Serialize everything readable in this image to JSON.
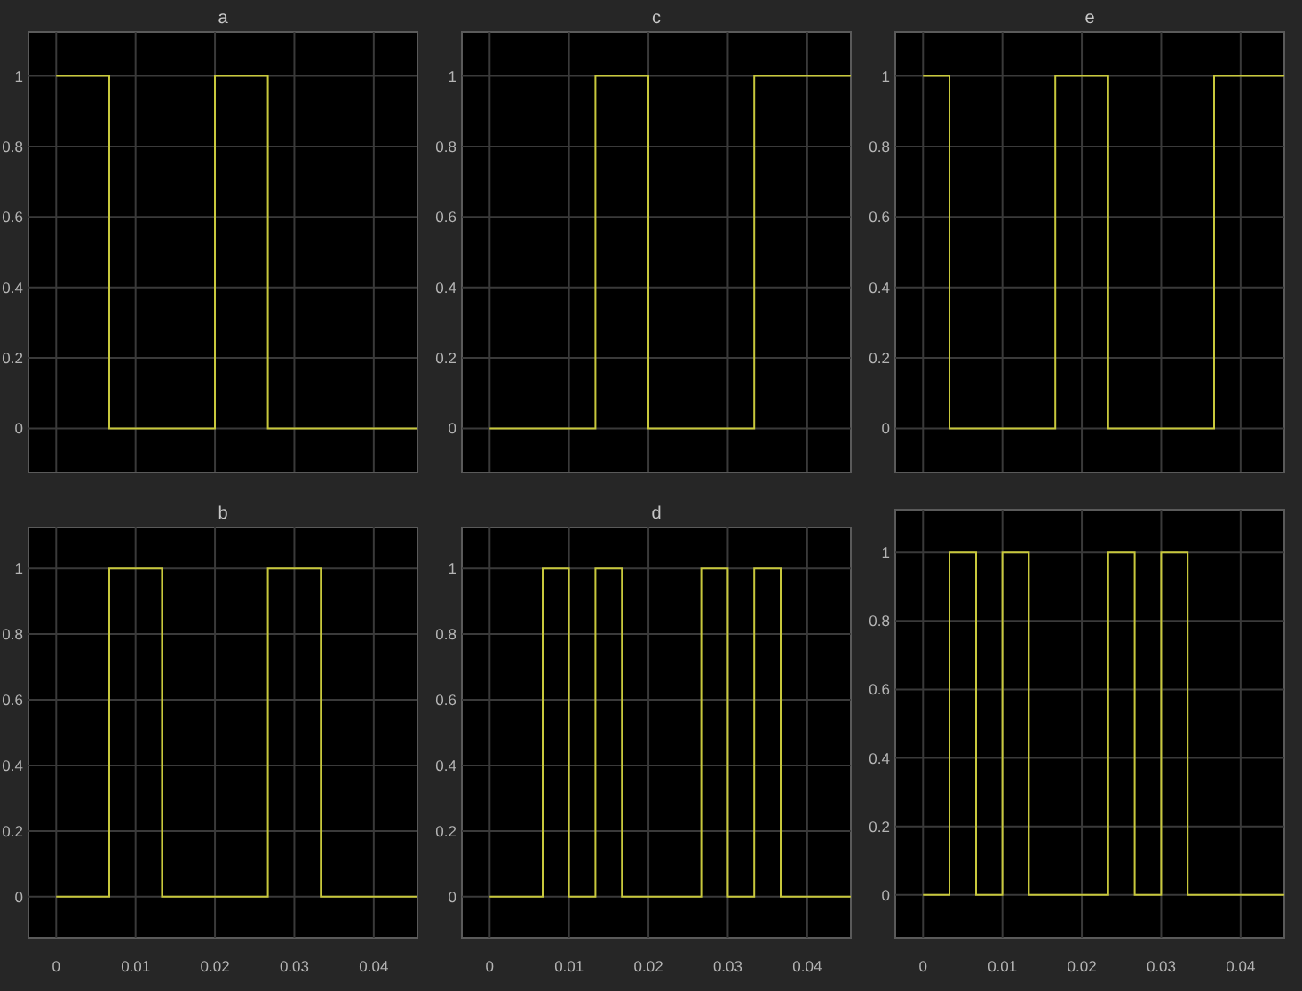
{
  "charts": [
    {
      "chart_data": {
        "type": "line",
        "title": "a",
        "grid": true,
        "xlim": [
          -0.0035,
          0.0455
        ],
        "ylim": [
          -0.125,
          1.125
        ],
        "yticks": [
          0,
          0.2,
          0.4,
          0.6,
          0.8,
          1
        ],
        "x": [
          0,
          0.00667,
          0.00667,
          0.02,
          0.02,
          0.02667,
          0.02667,
          0.0455
        ],
        "series": [
          {
            "color": "#c8c83c",
            "values": [
              1,
              1,
              0,
              0,
              1,
              1,
              0,
              0
            ]
          }
        ]
      }
    },
    {
      "chart_data": {
        "type": "line",
        "title": "c",
        "grid": true,
        "xlim": [
          -0.0035,
          0.0455
        ],
        "ylim": [
          -0.125,
          1.125
        ],
        "yticks": [
          0,
          0.2,
          0.4,
          0.6,
          0.8,
          1
        ],
        "x": [
          0,
          0.01333,
          0.01333,
          0.02,
          0.02,
          0.03333,
          0.03333,
          0.0455
        ],
        "series": [
          {
            "color": "#c8c83c",
            "values": [
              0,
              0,
              1,
              1,
              0,
              0,
              1,
              1
            ]
          }
        ]
      }
    },
    {
      "chart_data": {
        "type": "line",
        "title": "e",
        "grid": true,
        "xlim": [
          -0.0035,
          0.0455
        ],
        "ylim": [
          -0.125,
          1.125
        ],
        "yticks": [
          0,
          0.2,
          0.4,
          0.6,
          0.8,
          1
        ],
        "x": [
          0,
          0.00333,
          0.00333,
          0.01667,
          0.01667,
          0.02333,
          0.02333,
          0.03667,
          0.03667,
          0.0455
        ],
        "series": [
          {
            "color": "#c8c83c",
            "values": [
              1,
              1,
              0,
              0,
              1,
              1,
              0,
              0,
              1,
              1
            ]
          }
        ]
      }
    },
    {
      "chart_data": {
        "type": "line",
        "title": "b",
        "grid": true,
        "xlim": [
          -0.0035,
          0.0455
        ],
        "ylim": [
          -0.125,
          1.125
        ],
        "xticks": [
          0,
          0.01,
          0.02,
          0.03,
          0.04
        ],
        "yticks": [
          0,
          0.2,
          0.4,
          0.6,
          0.8,
          1
        ],
        "x": [
          0,
          0.00667,
          0.00667,
          0.01333,
          0.01333,
          0.02667,
          0.02667,
          0.03333,
          0.03333,
          0.0455
        ],
        "series": [
          {
            "color": "#c8c83c",
            "values": [
              0,
              0,
              1,
              1,
              0,
              0,
              1,
              1,
              0,
              0
            ]
          }
        ]
      }
    },
    {
      "chart_data": {
        "type": "line",
        "title": "d",
        "grid": true,
        "xlim": [
          -0.0035,
          0.0455
        ],
        "ylim": [
          -0.125,
          1.125
        ],
        "xticks": [
          0,
          0.01,
          0.02,
          0.03,
          0.04
        ],
        "yticks": [
          0,
          0.2,
          0.4,
          0.6,
          0.8,
          1
        ],
        "x": [
          0,
          0.00667,
          0.00667,
          0.01,
          0.01,
          0.01333,
          0.01333,
          0.01667,
          0.01667,
          0.02667,
          0.02667,
          0.03,
          0.03,
          0.03333,
          0.03333,
          0.03667,
          0.03667,
          0.0455
        ],
        "series": [
          {
            "color": "#c8c83c",
            "values": [
              0,
              0,
              1,
              1,
              0,
              0,
              1,
              1,
              0,
              0,
              1,
              1,
              0,
              0,
              1,
              1,
              0,
              0
            ]
          }
        ]
      }
    },
    {
      "chart_data": {
        "type": "line",
        "grid": true,
        "xlim": [
          -0.0035,
          0.0455
        ],
        "ylim": [
          -0.125,
          1.125
        ],
        "xticks": [
          0,
          0.01,
          0.02,
          0.03,
          0.04
        ],
        "yticks": [
          0,
          0.2,
          0.4,
          0.6,
          0.8,
          1
        ],
        "x": [
          0,
          0.00333,
          0.00333,
          0.00667,
          0.00667,
          0.01,
          0.01,
          0.01333,
          0.01333,
          0.02333,
          0.02333,
          0.02667,
          0.02667,
          0.03,
          0.03,
          0.03333,
          0.03333,
          0.0455
        ],
        "series": [
          {
            "color": "#c8c83c",
            "values": [
              0,
              0,
              1,
              1,
              0,
              0,
              1,
              1,
              0,
              0,
              1,
              1,
              0,
              0,
              1,
              1,
              0,
              0
            ]
          }
        ]
      }
    }
  ]
}
